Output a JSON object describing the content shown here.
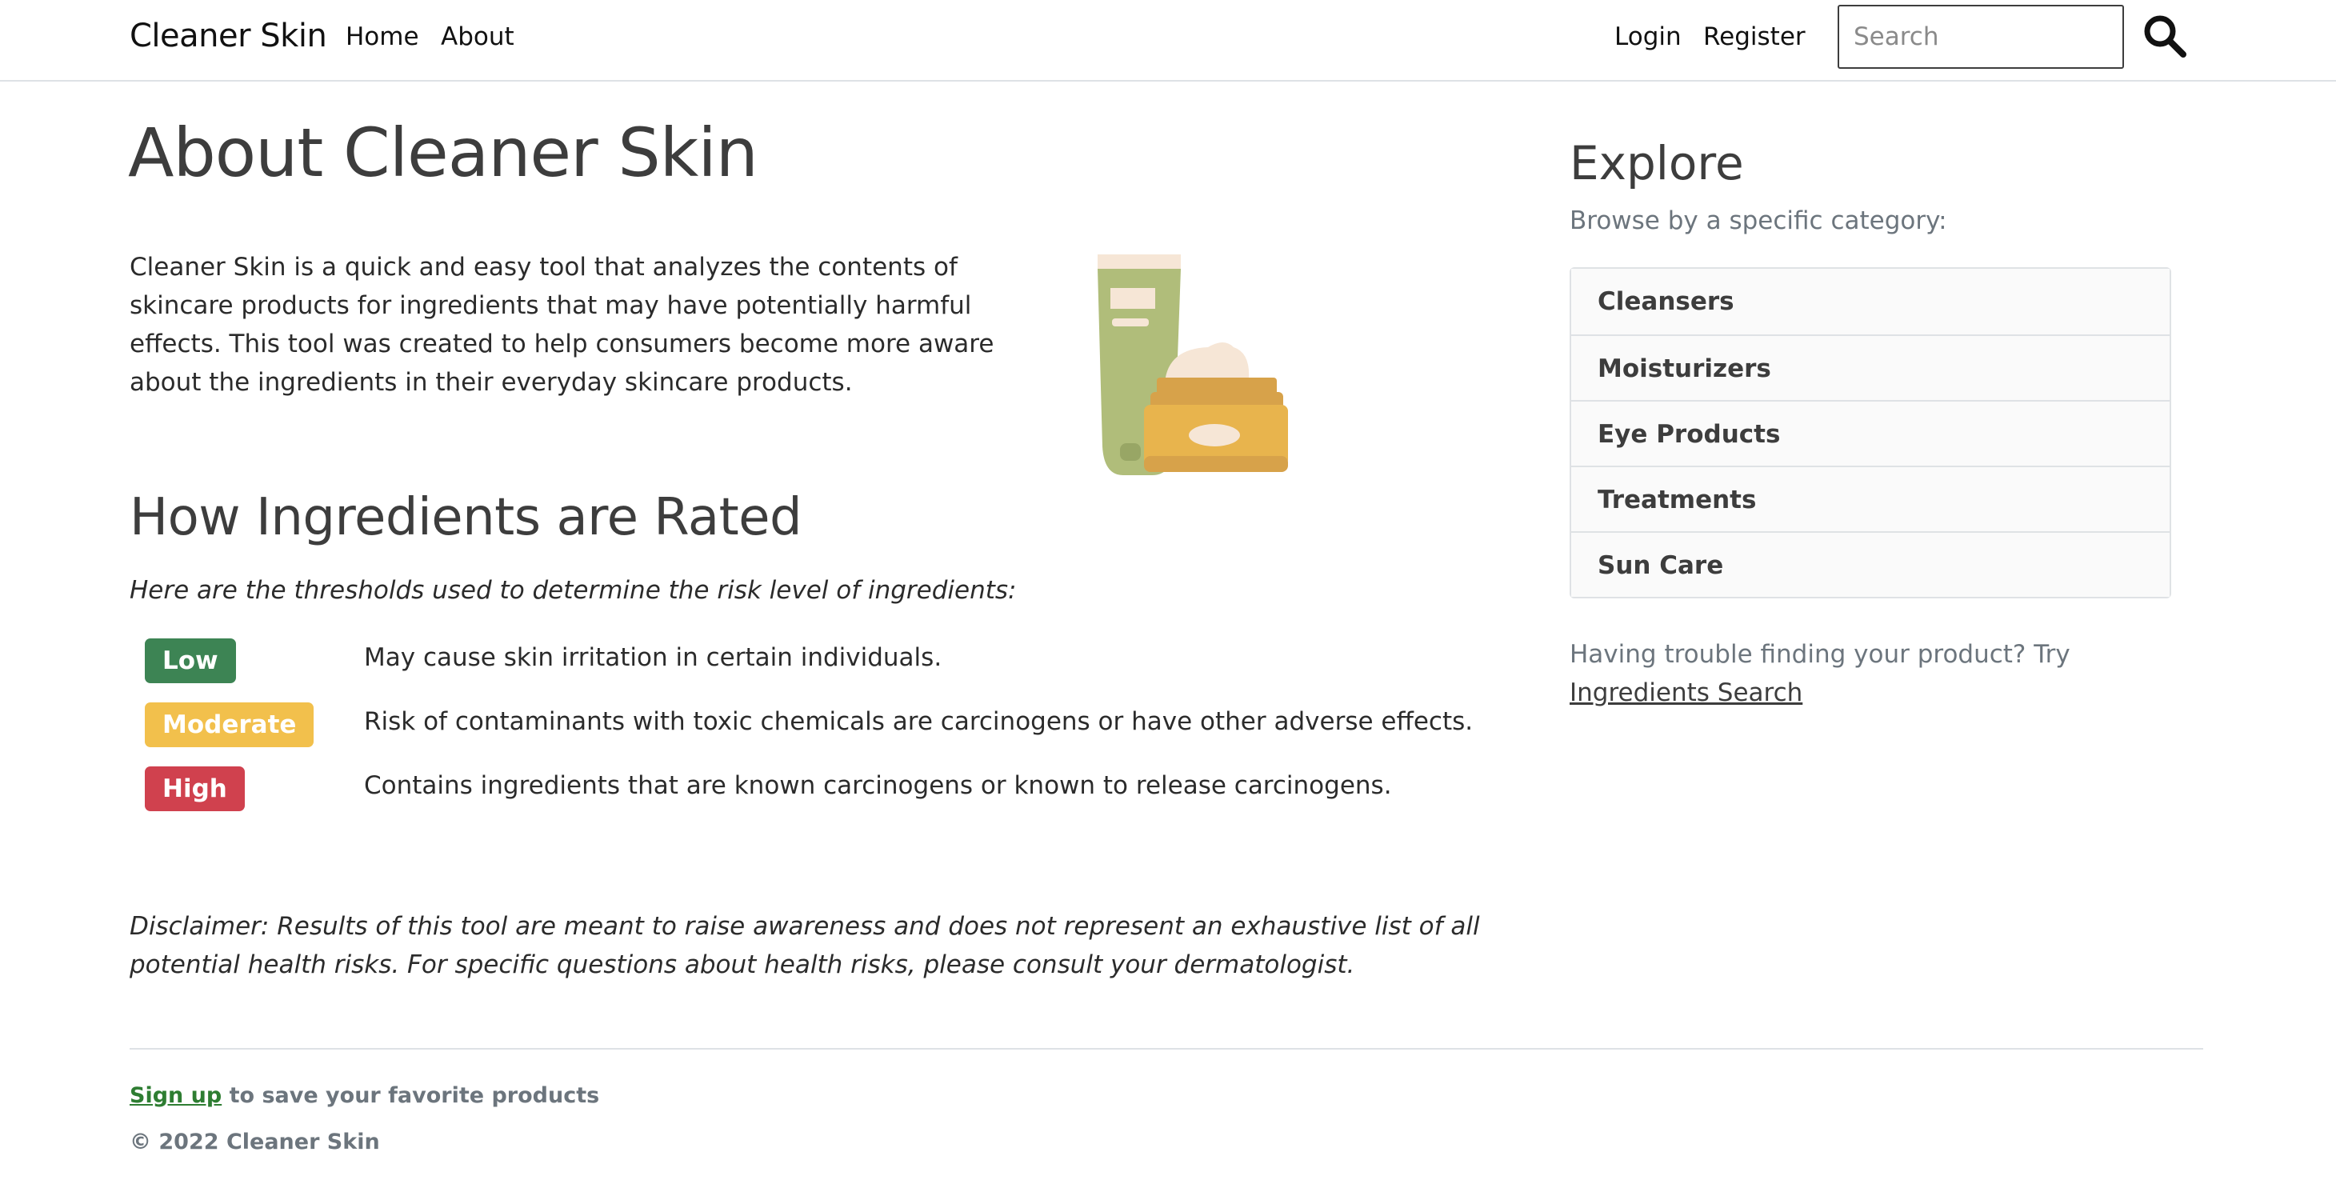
{
  "nav": {
    "brand": "Cleaner Skin",
    "links": [
      "Home",
      "About"
    ],
    "auth": [
      "Login",
      "Register"
    ],
    "search_placeholder": "Search",
    "search_icon": "search-icon"
  },
  "main": {
    "title": "About Cleaner Skin",
    "intro": "Cleaner Skin is a quick and easy tool that analyzes the contents of skincare products for ingredients that may have potentially harmful effects. This tool was created to help consumers become more aware about the ingredients in their everyday skincare products.",
    "rated_heading": "How Ingredients are Rated",
    "thresholds_intro": "Here are the thresholds used to determine the risk level of ingredients:",
    "levels": [
      {
        "label": "Low",
        "color": "#3d8454",
        "description": "May cause skin irritation in certain individuals."
      },
      {
        "label": "Moderate",
        "color": "#f2c04c",
        "description": "Risk of contaminants with toxic chemicals are carcinogens or have other adverse effects."
      },
      {
        "label": "High",
        "color": "#d0414e",
        "description": "Contains ingredients that are known carcinogens or known to release carcinogens."
      }
    ],
    "disclaimer": "Disclaimer: Results of this tool are meant to raise awareness and does not represent an exhaustive list of all potential health risks. For specific questions about health risks, please consult your dermatologist."
  },
  "sidebar": {
    "heading": "Explore",
    "subheading": "Browse by a specific category:",
    "categories": [
      "Cleansers",
      "Moisturizers",
      "Eye Products",
      "Treatments",
      "Sun Care"
    ],
    "trouble_text": "Having trouble finding your product? Try ",
    "trouble_link": "Ingredients Search"
  },
  "footer": {
    "signup_link": "Sign up",
    "signup_text": " to save your favorite products",
    "copyright": "© 2022 Cleaner Skin"
  },
  "colors": {
    "brand_green": "#2e7d32",
    "muted": "#6c757d",
    "heading": "#3d3d3d"
  }
}
